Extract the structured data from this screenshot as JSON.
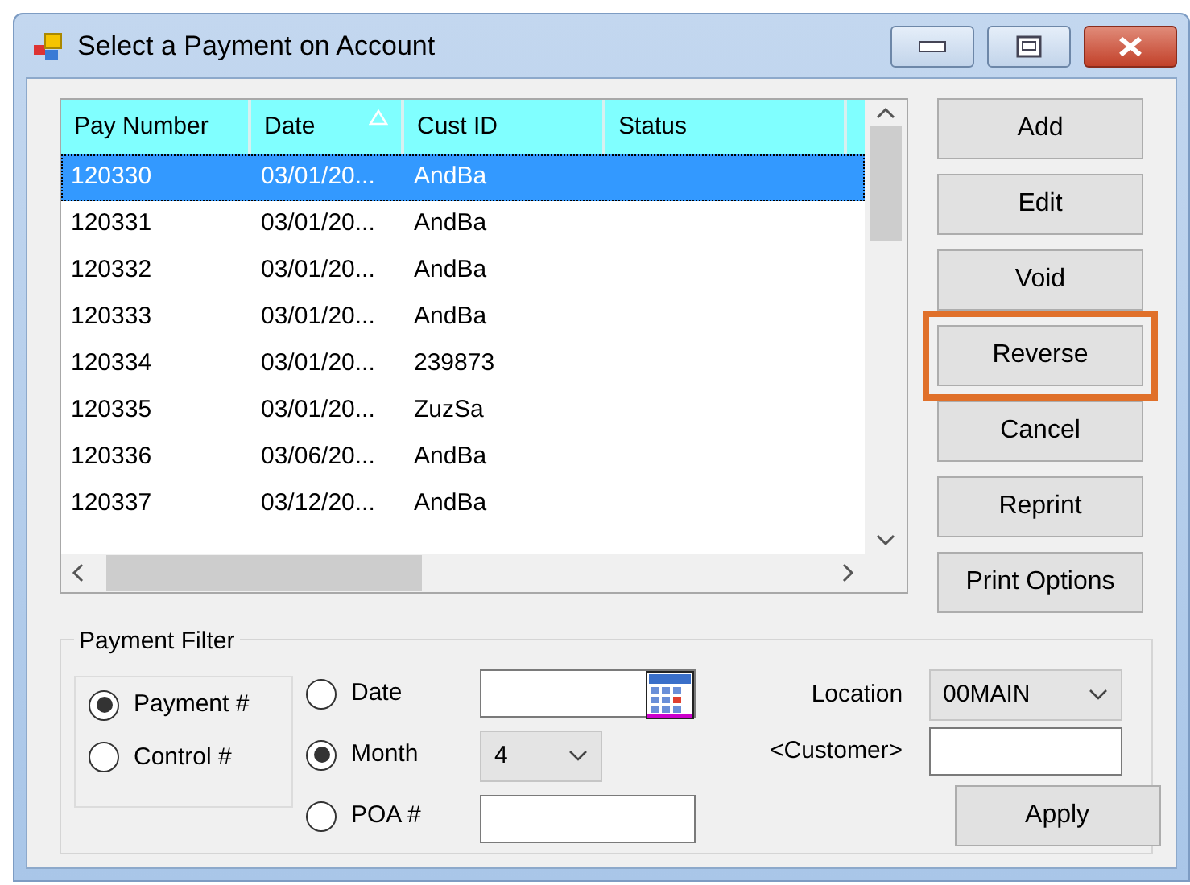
{
  "window": {
    "title": "Select a Payment on Account"
  },
  "table": {
    "columns": [
      {
        "label": "Pay Number",
        "sorted": false
      },
      {
        "label": "Date",
        "sorted": true
      },
      {
        "label": "Cust ID",
        "sorted": false
      },
      {
        "label": "Status",
        "sorted": false
      }
    ],
    "rows": [
      {
        "cells": [
          "120330",
          "03/01/20...",
          "AndBa",
          ""
        ],
        "selected": true
      },
      {
        "cells": [
          "120331",
          "03/01/20...",
          "AndBa",
          ""
        ],
        "selected": false
      },
      {
        "cells": [
          "120332",
          "03/01/20...",
          "AndBa",
          ""
        ],
        "selected": false
      },
      {
        "cells": [
          "120333",
          "03/01/20...",
          "AndBa",
          ""
        ],
        "selected": false
      },
      {
        "cells": [
          "120334",
          "03/01/20...",
          "239873",
          ""
        ],
        "selected": false
      },
      {
        "cells": [
          "120335",
          "03/01/20...",
          "ZuzSa",
          ""
        ],
        "selected": false
      },
      {
        "cells": [
          "120336",
          "03/06/20...",
          "AndBa",
          ""
        ],
        "selected": false
      },
      {
        "cells": [
          "120337",
          "03/12/20...",
          "AndBa",
          ""
        ],
        "selected": false
      }
    ]
  },
  "buttons": [
    {
      "label": "Add",
      "highlighted": false
    },
    {
      "label": "Edit",
      "highlighted": false
    },
    {
      "label": "Void",
      "highlighted": false
    },
    {
      "label": "Reverse",
      "highlighted": true
    },
    {
      "label": "Cancel",
      "highlighted": false
    },
    {
      "label": "Reprint",
      "highlighted": false
    },
    {
      "label": "Print Options",
      "highlighted": false
    }
  ],
  "filter": {
    "title": "Payment Filter",
    "by": [
      {
        "label": "Payment #",
        "selected": true
      },
      {
        "label": "Control #",
        "selected": false
      }
    ],
    "range": [
      {
        "label": "Date",
        "selected": false,
        "kind": "date"
      },
      {
        "label": "Month",
        "selected": true,
        "kind": "select",
        "value": "4"
      },
      {
        "label": "POA #",
        "selected": false,
        "kind": "text"
      }
    ],
    "location": {
      "label": "Location",
      "value": "00MAIN"
    },
    "customer": {
      "label": "<Customer>"
    },
    "apply": "Apply"
  }
}
